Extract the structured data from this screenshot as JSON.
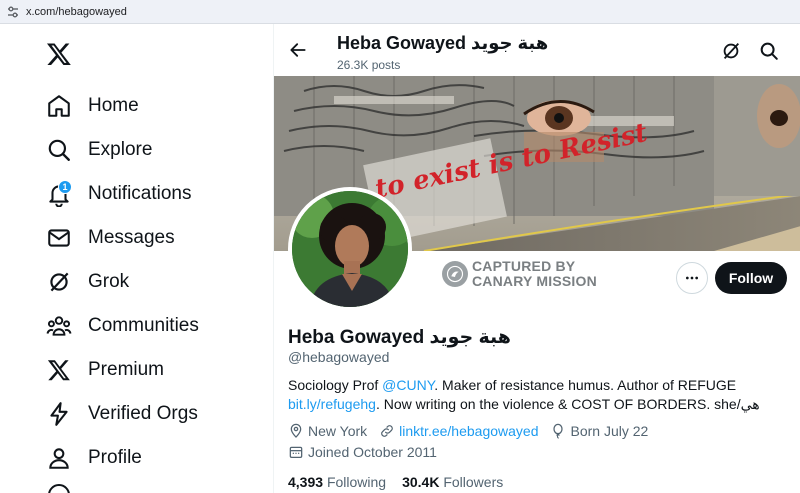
{
  "browser": {
    "url": "x.com/hebagowayed"
  },
  "sidebar": {
    "items": [
      {
        "label": "Home"
      },
      {
        "label": "Explore"
      },
      {
        "label": "Notifications",
        "badge": "1"
      },
      {
        "label": "Messages"
      },
      {
        "label": "Grok"
      },
      {
        "label": "Communities"
      },
      {
        "label": "Premium"
      },
      {
        "label": "Verified Orgs"
      },
      {
        "label": "Profile"
      }
    ]
  },
  "header": {
    "name": "Heba Gowayed هبة جويد",
    "posts": "26.3K posts"
  },
  "banner": {
    "mural_text": "to exist is to Resist"
  },
  "stamp": {
    "line1": "CAPTURED BY",
    "line2": "CANARY MISSION"
  },
  "actions": {
    "follow": "Follow"
  },
  "profile": {
    "name": "Heba Gowayed هبة جويد",
    "handle": "@hebagowayed",
    "bio": {
      "p1": "Sociology Prof ",
      "mention": "@CUNY",
      "p2": ". Maker of resistance humus. Author of REFUGE",
      "link": "bit.ly/refugehg",
      "p3": ". Now writing on the violence & COST OF BORDERS. she/هي"
    },
    "location": "New York",
    "website": "linktr.ee/hebagowayed",
    "born": "Born July 22",
    "joined": "Joined October 2011",
    "following_count": "4,393",
    "following_label": "Following",
    "followers_count": "30.4K",
    "followers_label": "Followers"
  },
  "colors": {
    "accent": "#1d9bf0",
    "text": "#0f1419",
    "muted": "#536471"
  }
}
